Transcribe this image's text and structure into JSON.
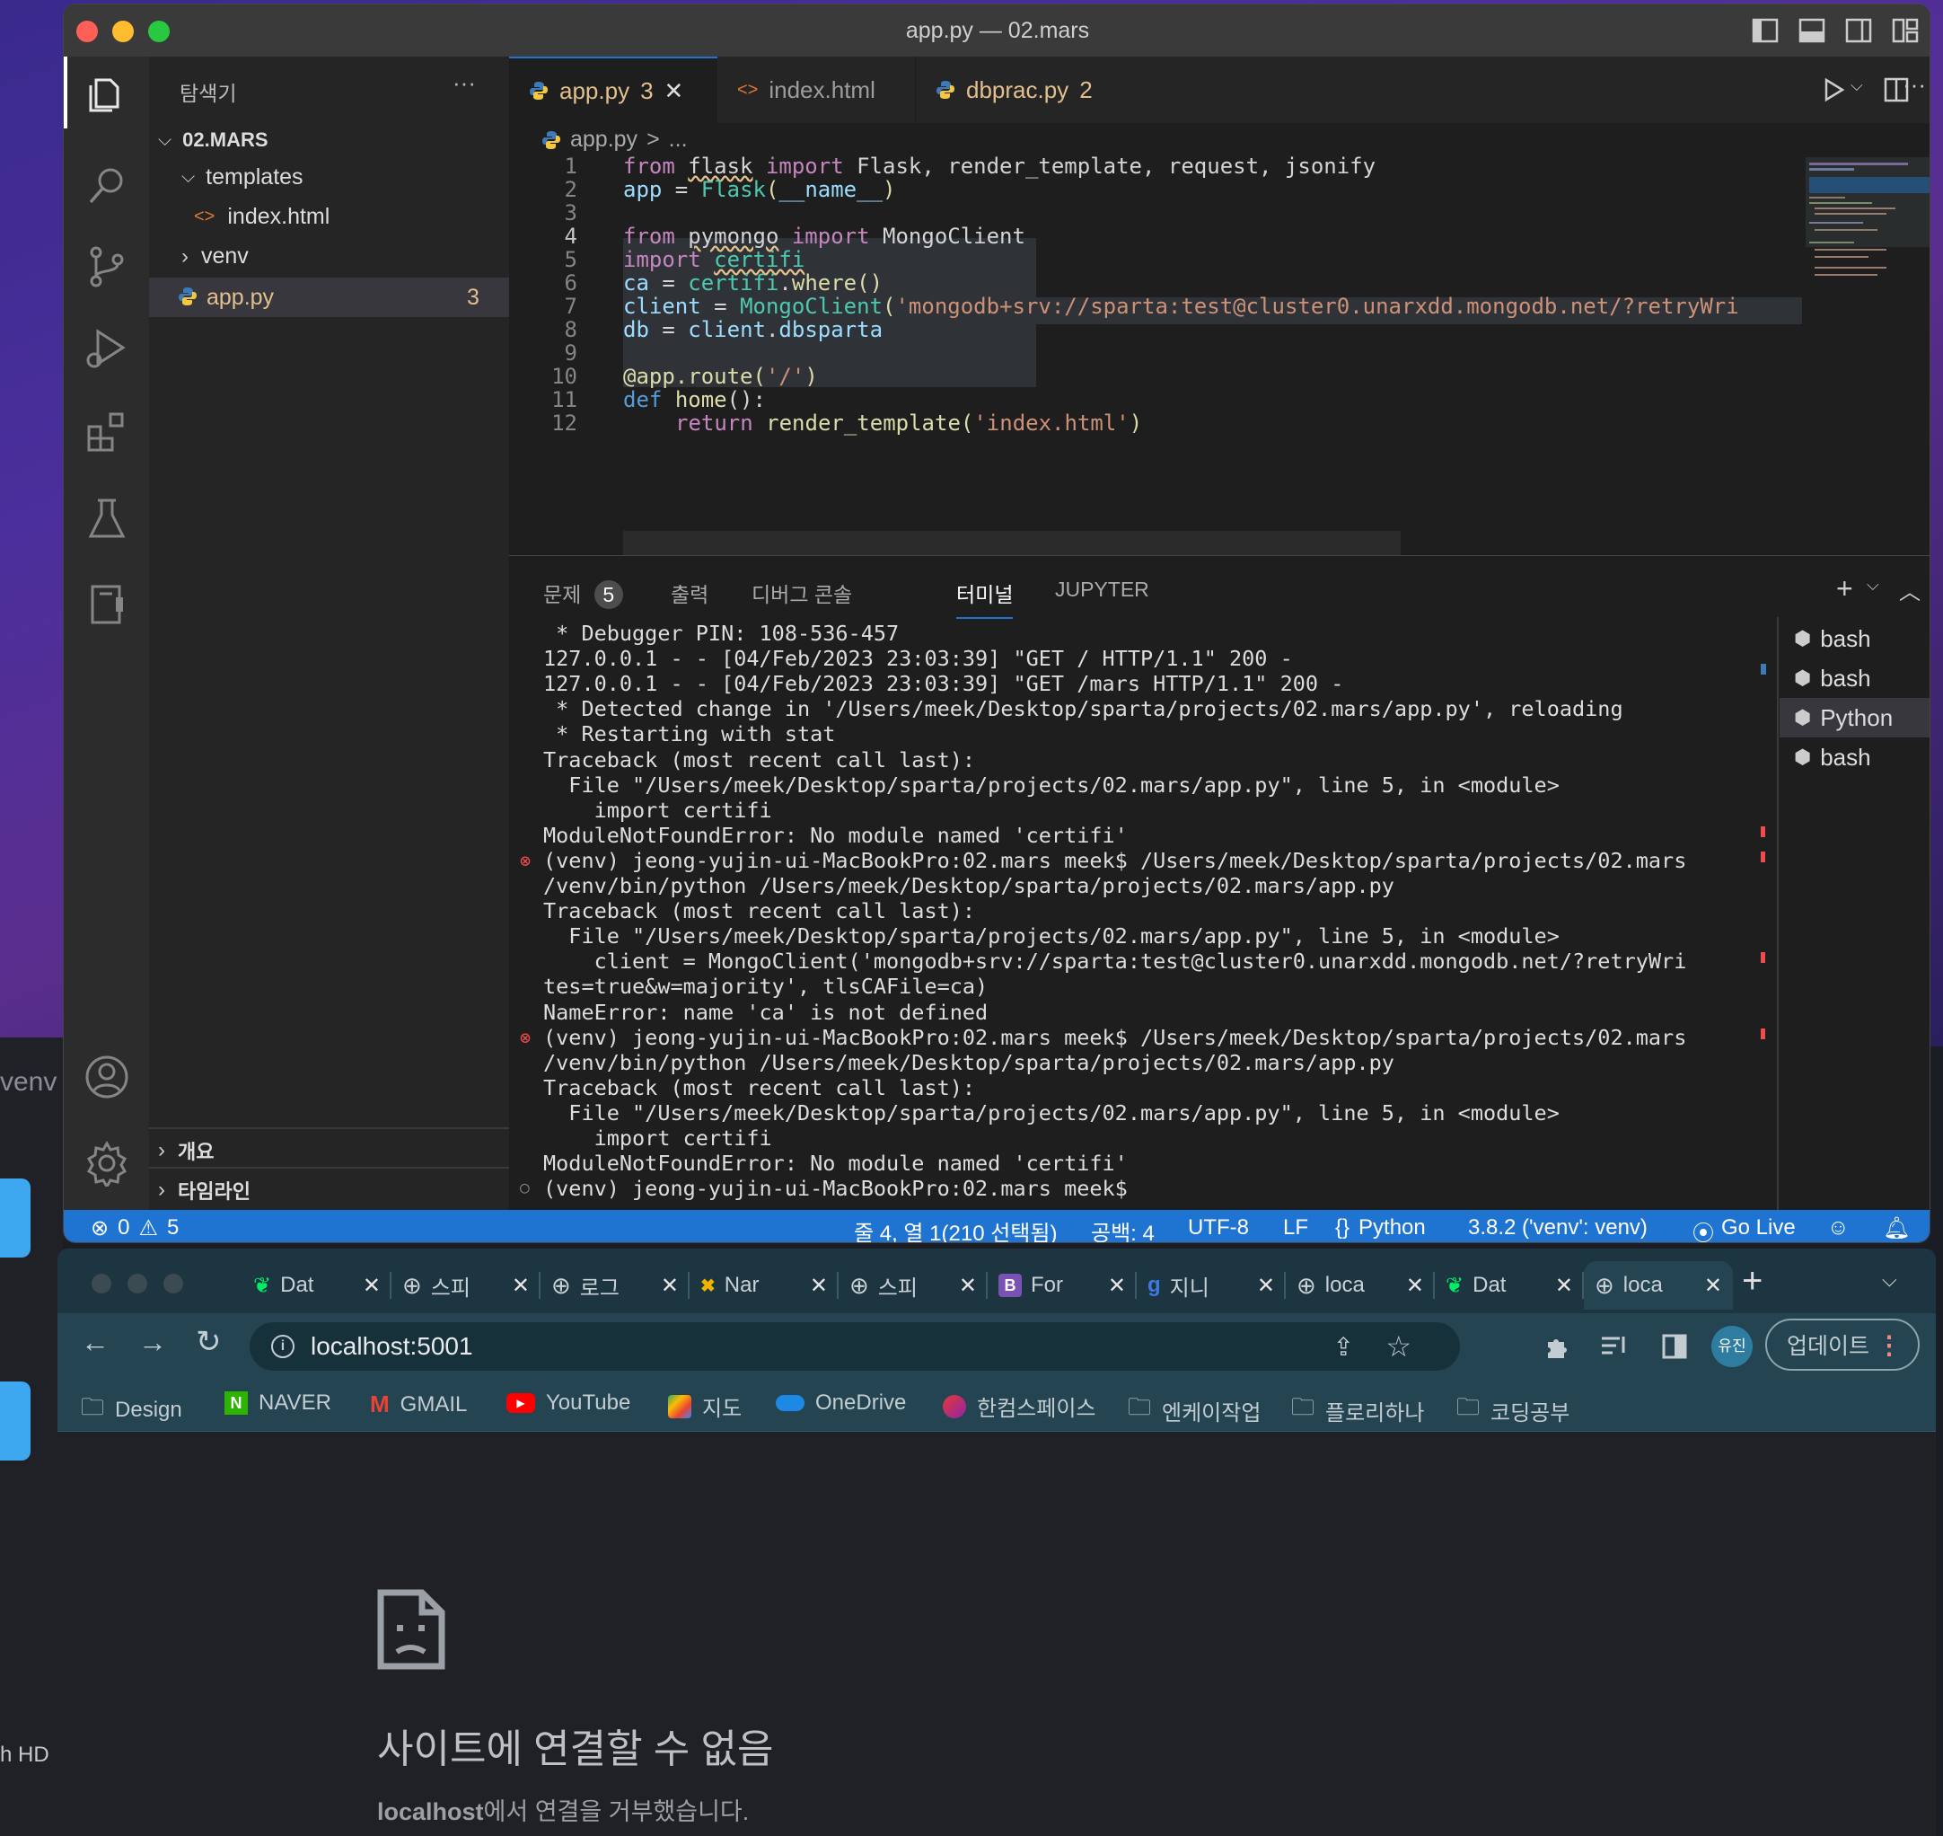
{
  "desktop": {
    "venv_label": "venv",
    "hd_label": "h HD"
  },
  "vscode": {
    "title": "app.py — 02.mars",
    "sidebar": {
      "header": "탐색기",
      "more": "···",
      "root": "02.MARS",
      "tree": [
        {
          "label": "templates"
        },
        {
          "label": "index.html"
        },
        {
          "label": "venv"
        },
        {
          "label": "app.py",
          "badge": "3"
        }
      ],
      "outline": "개요",
      "timeline": "타임라인"
    },
    "tabs": [
      {
        "label": "app.py",
        "badge": "3",
        "close": "✕"
      },
      {
        "label": "index.html"
      },
      {
        "label": "dbprac.py",
        "badge": "2"
      }
    ],
    "breadcrumb": {
      "file": "app.py",
      "sep": ">",
      "rest": "..."
    },
    "code_lines": [
      "1",
      "2",
      "3",
      "4",
      "5",
      "6",
      "7",
      "8",
      "9",
      "10",
      "11",
      "12"
    ],
    "code": {
      "l1": {
        "a": "from",
        "b": "flask",
        "c": "import",
        "d": "Flask, render_template, request, jsonify"
      },
      "l2": {
        "a": "app",
        "b": " = ",
        "c": "Flask",
        "d": "(",
        "e": "__name__",
        "f": ")"
      },
      "l4": {
        "a": "from",
        "b": "pymongo",
        "c": "import",
        "d": "MongoClient"
      },
      "l5": {
        "a": "import",
        "b": "certifi"
      },
      "l6": {
        "a": "ca",
        "b": " = ",
        "c": "certifi",
        "d": ".",
        "e": "where",
        "f": "()"
      },
      "l7": {
        "a": "client",
        "b": " = ",
        "c": "MongoClient",
        "d": "(",
        "e": "'mongodb+srv://sparta:test@cluster0.unarxdd.mongodb.net/?retryWri"
      },
      "l8": {
        "a": "db",
        "b": " = ",
        "c": "client",
        "d": ".",
        "e": "dbsparta"
      },
      "l10": {
        "a": "@app.route",
        "b": "(",
        "c": "'/'",
        "d": ")"
      },
      "l11": {
        "a": "def",
        "b": "home",
        "c": "():"
      },
      "l12": {
        "a": "return",
        "b": "render_template",
        "c": "(",
        "d": "'index.html'",
        "e": ")"
      }
    },
    "panel": {
      "tabs": [
        {
          "label": "문제",
          "badge": "5"
        },
        {
          "label": "출력"
        },
        {
          "label": "디버그 콘솔"
        },
        {
          "label": "터미널"
        },
        {
          "label": "JUPYTER"
        }
      ],
      "terminal_lines": [
        " * Debugger PIN: 108-536-457",
        "127.0.0.1 - - [04/Feb/2023 23:03:39] \"GET / HTTP/1.1\" 200 -",
        "127.0.0.1 - - [04/Feb/2023 23:03:39] \"GET /mars HTTP/1.1\" 200 -",
        " * Detected change in '/Users/meek/Desktop/sparta/projects/02.mars/app.py', reloading",
        " * Restarting with stat",
        "Traceback (most recent call last):",
        "  File \"/Users/meek/Desktop/sparta/projects/02.mars/app.py\", line 5, in <module>",
        "    import certifi",
        "ModuleNotFoundError: No module named 'certifi'",
        "(venv) jeong-yujin-ui-MacBookPro:02.mars meek$ /Users/meek/Desktop/sparta/projects/02.mars",
        "/venv/bin/python /Users/meek/Desktop/sparta/projects/02.mars/app.py",
        "Traceback (most recent call last):",
        "  File \"/Users/meek/Desktop/sparta/projects/02.mars/app.py\", line 5, in <module>",
        "    client = MongoClient('mongodb+srv://sparta:test@cluster0.unarxdd.mongodb.net/?retryWri",
        "tes=true&w=majority', tlsCAFile=ca)",
        "NameError: name 'ca' is not defined",
        "(venv) jeong-yujin-ui-MacBookPro:02.mars meek$ /Users/meek/Desktop/sparta/projects/02.mars",
        "/venv/bin/python /Users/meek/Desktop/sparta/projects/02.mars/app.py",
        "Traceback (most recent call last):",
        "  File \"/Users/meek/Desktop/sparta/projects/02.mars/app.py\", line 5, in <module>",
        "    import certifi",
        "ModuleNotFoundError: No module named 'certifi'",
        "(venv) jeong-yujin-ui-MacBookPro:02.mars meek$"
      ],
      "terminals": [
        "bash",
        "bash",
        "Python",
        "bash"
      ]
    },
    "status": {
      "errors": "0",
      "warnings": "5",
      "position": "줄 4, 열 1(210 선택됨)",
      "spaces": "공백: 4",
      "encoding": "UTF-8",
      "eol": "LF",
      "language": "Python",
      "interpreter": "3.8.2 ('venv': venv)",
      "golive": "Go Live"
    }
  },
  "chrome": {
    "tabs": [
      {
        "title": "Dat",
        "icon": "mongodb-leaf-icon"
      },
      {
        "title": "스피",
        "icon": "globe-icon"
      },
      {
        "title": "로그",
        "icon": "globe-icon"
      },
      {
        "title": "Nar",
        "icon": "naver-blog-icon"
      },
      {
        "title": "스피",
        "icon": "globe-icon"
      },
      {
        "title": "For",
        "icon": "bootstrap-icon"
      },
      {
        "title": "지니",
        "icon": "genie-icon"
      },
      {
        "title": "loca",
        "icon": "globe-icon"
      },
      {
        "title": "Dat",
        "icon": "mongodb-leaf-icon"
      },
      {
        "title": "loca",
        "icon": "globe-icon"
      }
    ],
    "url": "localhost:5001",
    "profile": "유진",
    "update": "업데이트",
    "bookmarks": [
      "Design",
      "NAVER",
      "GMAIL",
      "YouTube",
      "지도",
      "OneDrive",
      "한컴스페이스",
      "엔케이작업",
      "플로리하나",
      "코딩공부"
    ],
    "error": {
      "title": "사이트에 연결할 수 없음",
      "host": "localhost",
      "message": "에서 연결을 거부했습니다."
    }
  }
}
